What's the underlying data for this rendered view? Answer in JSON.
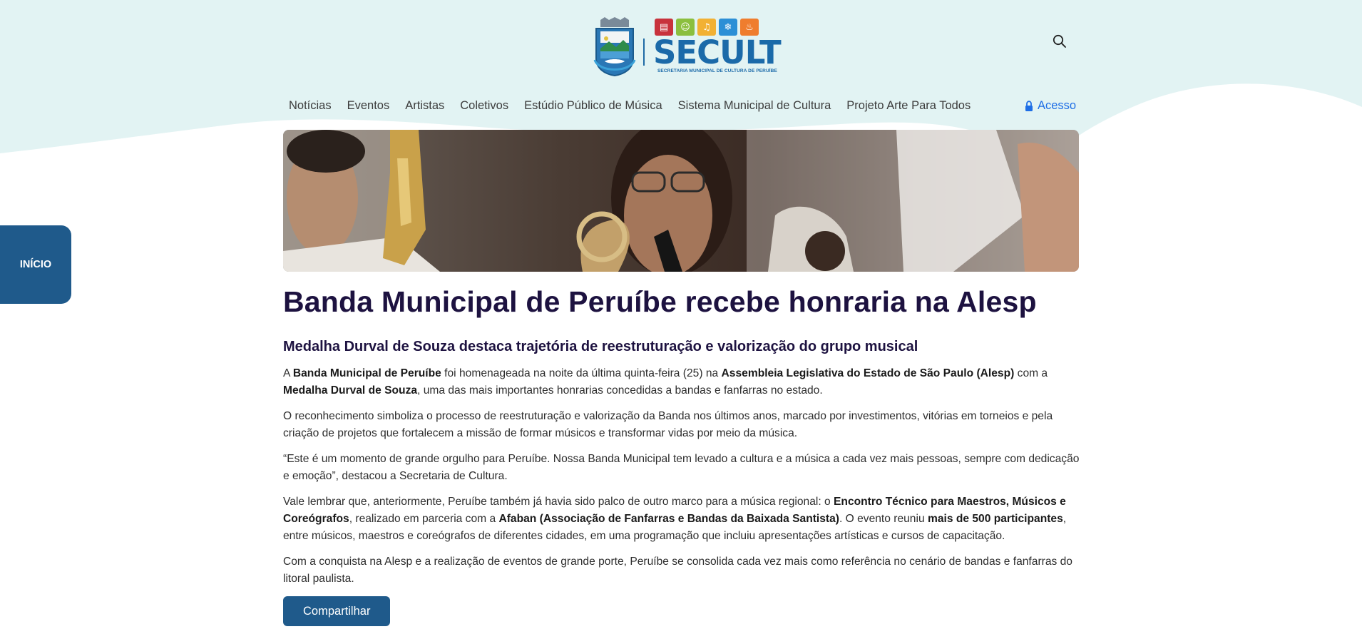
{
  "colors": {
    "primary": "#1f5a8b",
    "headline": "#1d1240",
    "link": "#1e6ee6",
    "wave": "#e2f3f3"
  },
  "header": {
    "brand": "SECULT",
    "brand_subtitle": "SECRETARIA MUNICIPAL DE CULTURA DE PERUÍBE",
    "search_icon": "search-icon"
  },
  "nav": {
    "items": [
      "Notícias",
      "Eventos",
      "Artistas",
      "Coletivos",
      "Estúdio Público de Música",
      "Sistema Municipal de Cultura",
      "Projeto Arte Para Todos"
    ],
    "access_label": "Acesso",
    "access_icon": "lock-icon"
  },
  "side_tab": {
    "label": "INÍCIO"
  },
  "article": {
    "title": "Banda Municipal de Peruíbe recebe honraria na Alesp",
    "subtitle": "Medalha Durval de Souza destaca trajetória de reestruturação e valorização do grupo musical",
    "p1": {
      "t1": "A ",
      "b1": "Banda Municipal de Peruíbe",
      "t2": " foi homenageada na noite da última quinta-feira (25) na ",
      "b2": "Assembleia Legislativa do Estado de São Paulo (Alesp)",
      "t3": " com a ",
      "b3": "Medalha Durval de Souza",
      "t4": ", uma das mais importantes honrarias concedidas a bandas e fanfarras no estado."
    },
    "p2": "O reconhecimento simboliza o processo de reestruturação e valorização da Banda nos últimos anos, marcado por investimentos, vitórias em torneios e pela criação de projetos que fortalecem a missão de formar músicos e transformar vidas por meio da música.",
    "p3": "“Este é um momento de grande orgulho para Peruíbe. Nossa Banda Municipal tem levado a cultura e a música a cada vez mais pessoas, sempre com dedicação e emoção”, destacou a Secretaria de Cultura.",
    "p4": {
      "t1": "Vale lembrar que, anteriormente, Peruíbe também já havia sido palco de outro marco para a música regional: o ",
      "b1": "Encontro Técnico para Maestros, Músicos e Coreógrafos",
      "t2": ", realizado em parceria com a ",
      "b2": "Afaban (Associação de Fanfarras e Bandas da Baixada Santista)",
      "t3": ". O evento reuniu ",
      "b3": "mais de 500 participantes",
      "t4": ", entre músicos, maestros e coreógrafos de diferentes cidades, em uma programação que incluiu apresentações artísticas e cursos de capacitação."
    },
    "p5": "Com a conquista na Alesp e a realização de eventos de grande porte, Peruíbe se consolida cada vez mais como referência no cenário de bandas e fanfarras do litoral paulista.",
    "share_label": "Compartilhar"
  }
}
